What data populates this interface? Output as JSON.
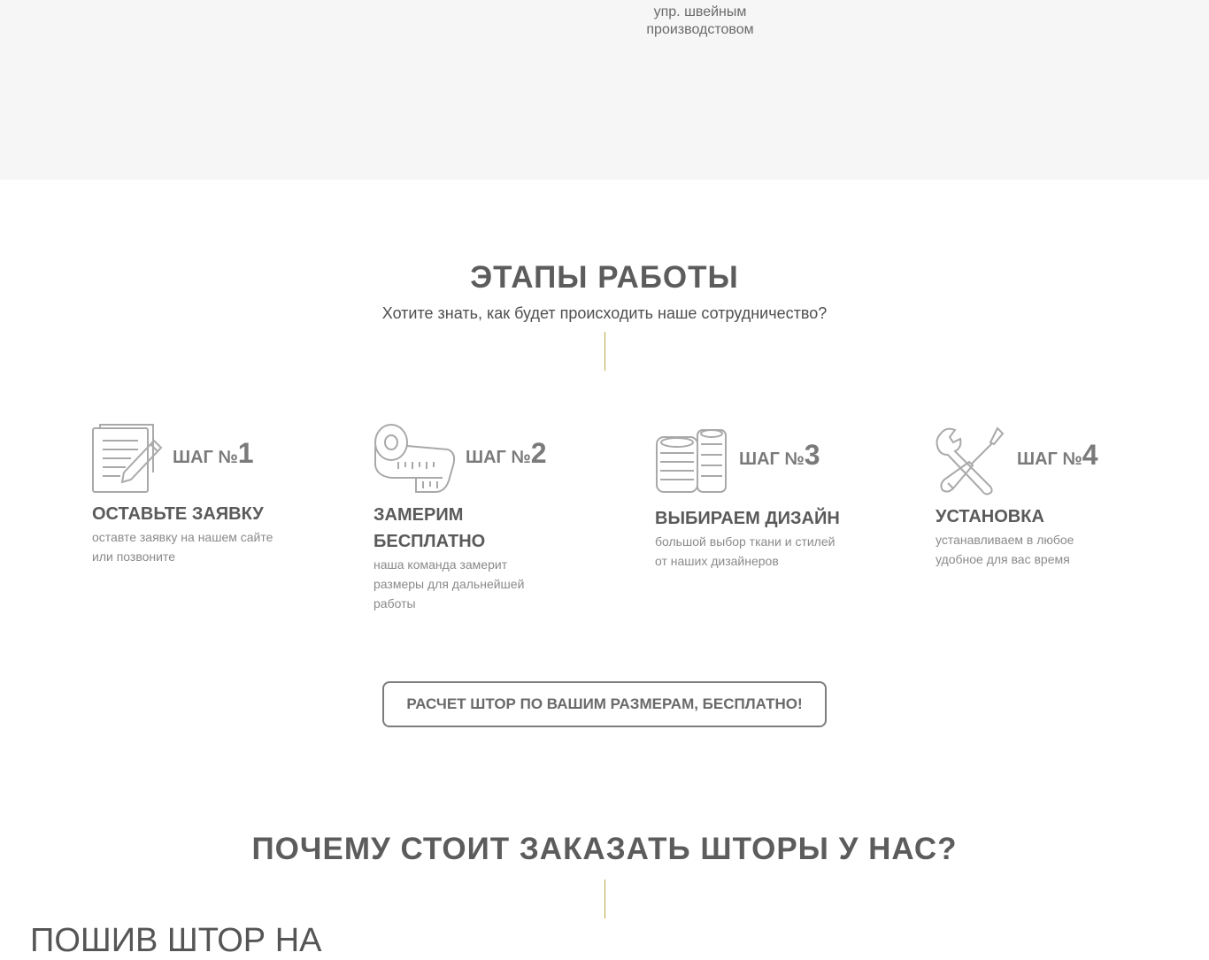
{
  "top_section": {
    "caption_line1": "упр. швейным",
    "caption_line2": "производстовом"
  },
  "stages": {
    "title": "ЭТАПЫ РАБОТЫ",
    "subtitle": "Хотите знать, как будет происходить наше сотрудничество?",
    "steps": [
      {
        "icon": "document-pencil-icon",
        "label": "ШАГ №",
        "number": "1",
        "title_line1": "ОСТАВЬТЕ ЗАЯВКУ",
        "title_line2": "",
        "desc_line1": "оставте заявку на нашем сайте",
        "desc_line2": "или позвоните",
        "desc_line3": ""
      },
      {
        "icon": "measuring-tape-icon",
        "label": "ШАГ №",
        "number": "2",
        "title_line1": "ЗАМЕРИМ",
        "title_line2": "БЕСПЛАТНО",
        "desc_line1": "наша команда замерит",
        "desc_line2": "размеры для дальнейшей",
        "desc_line3": "работы"
      },
      {
        "icon": "fabric-rolls-icon",
        "label": "ШАГ №",
        "number": "3",
        "title_line1": "ВЫБИРАЕМ ДИЗАЙН",
        "title_line2": "",
        "desc_line1": "большой выбор ткани и стилей",
        "desc_line2": "от наших дизайнеров",
        "desc_line3": ""
      },
      {
        "icon": "wrench-screwdriver-icon",
        "label": "ШАГ №",
        "number": "4",
        "title_line1": "УСТАНОВКА",
        "title_line2": "",
        "desc_line1": "устанавливаем в любое",
        "desc_line2": "удобное для вас время",
        "desc_line3": ""
      }
    ],
    "cta_label": "РАСЧЕТ ШТОР ПО ВАШИМ РАЗМЕРАМ, БЕСПЛАТНО!"
  },
  "why": {
    "title": "ПОЧЕМУ СТОИТ ЗАКАЗАТЬ ШТОРЫ У НАС?",
    "partial_heading": "ПОШИВ ШТОР НА"
  },
  "colors": {
    "accent_line": "#b9ab3f",
    "top_band": "#f6f6f6",
    "text_dark": "#5c5c5c",
    "icon_stroke": "#a9a9a9"
  }
}
